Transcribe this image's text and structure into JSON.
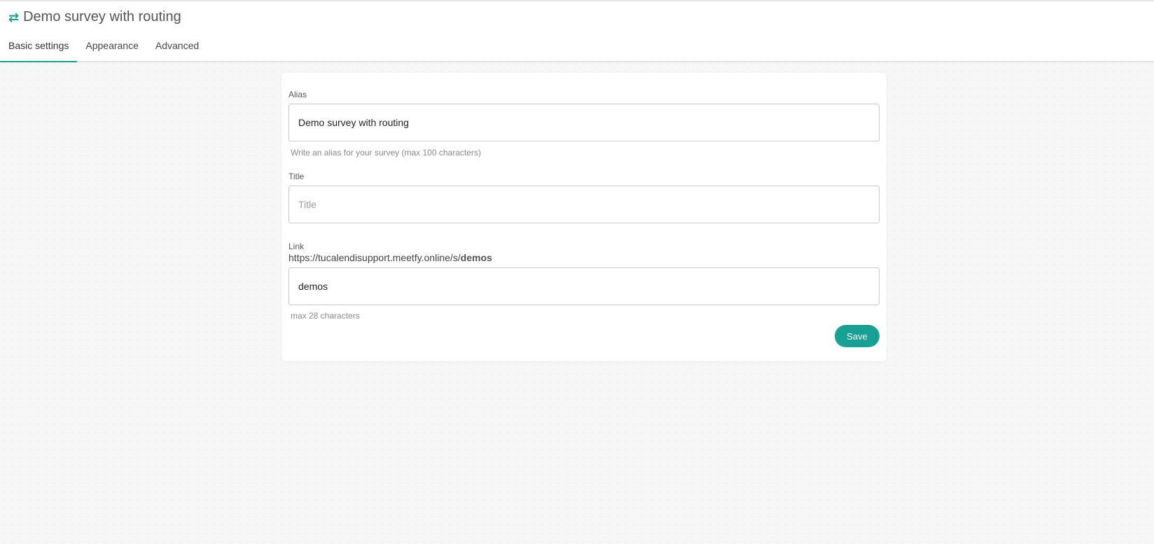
{
  "header": {
    "icon": "swap-arrows-icon",
    "title": "Demo survey with routing"
  },
  "tabs": [
    {
      "label": "Basic settings",
      "active": true
    },
    {
      "label": "Appearance",
      "active": false
    },
    {
      "label": "Advanced",
      "active": false
    }
  ],
  "form": {
    "alias": {
      "label": "Alias",
      "value": "Demo survey with routing",
      "hint": "Write an alias for your survey (max 100 characters)"
    },
    "title": {
      "label": "Title",
      "value": "",
      "placeholder": "Title"
    },
    "link": {
      "label": "Link",
      "url_prefix": "https://tucalendisupport.meetfy.online/s/",
      "slug_bold": "demos",
      "value": "demos",
      "hint": "max 28 characters"
    },
    "save_label": "Save"
  },
  "colors": {
    "accent": "#17a093",
    "background": "#f7f7f7"
  }
}
